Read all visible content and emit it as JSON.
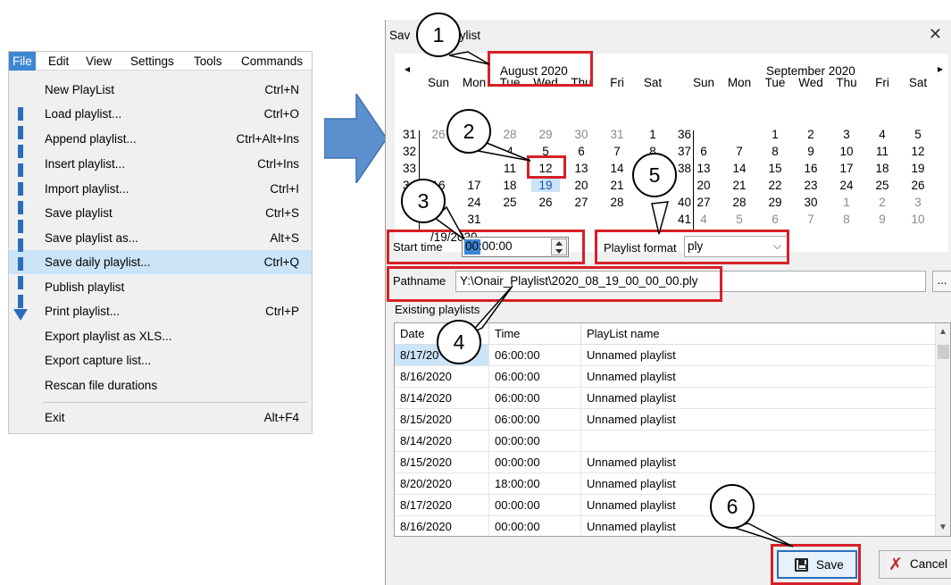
{
  "menubar": [
    {
      "label": "File",
      "active": true
    },
    {
      "label": "Edit"
    },
    {
      "label": "View"
    },
    {
      "label": "Settings"
    },
    {
      "label": "Tools"
    },
    {
      "label": "Commands"
    }
  ],
  "file_menu": [
    {
      "label": "New PlayList",
      "shortcut": "Ctrl+N"
    },
    {
      "label": "Load playlist...",
      "shortcut": "Ctrl+O"
    },
    {
      "label": "Append playlist...",
      "shortcut": "Ctrl+Alt+Ins"
    },
    {
      "label": "Insert playlist...",
      "shortcut": "Ctrl+Ins"
    },
    {
      "label": "Import playlist...",
      "shortcut": "Ctrl+I"
    },
    {
      "label": "Save playlist",
      "shortcut": "Ctrl+S"
    },
    {
      "label": "Save playlist as...",
      "shortcut": "Alt+S"
    },
    {
      "label": "Save daily playlist...",
      "shortcut": "Ctrl+Q",
      "highlighted": true
    },
    {
      "label": "Publish playlist",
      "shortcut": ""
    },
    {
      "label": "Print playlist...",
      "shortcut": "Ctrl+P"
    },
    {
      "label": "Export playlist as XLS...",
      "shortcut": ""
    },
    {
      "label": "Export capture list...",
      "shortcut": ""
    },
    {
      "label": "Rescan file durations",
      "shortcut": ""
    },
    {
      "label": "Exit",
      "shortcut": "Alt+F4"
    }
  ],
  "dialog": {
    "title_left": "Sav",
    "title_right": "aylist",
    "close_glyph": "✕"
  },
  "calendar": {
    "prev_glyph": "◂",
    "next_glyph": "▸",
    "left_month": "August 2020",
    "right_month": "September 2020",
    "weekdays": [
      "Sun",
      "Mon",
      "Tue",
      "Wed",
      "Thu",
      "Fri",
      "Sat"
    ],
    "left_weeks": [
      "31",
      "32",
      "33",
      "34",
      "",
      ""
    ],
    "left_days": [
      [
        "26",
        "",
        "28",
        "29",
        "30",
        "31",
        "1"
      ],
      [
        "",
        "",
        "4",
        "5",
        "6",
        "7",
        "8"
      ],
      [
        "",
        "",
        "11",
        "12",
        "13",
        "14",
        "15"
      ],
      [
        "16",
        "17",
        "18",
        "19",
        "20",
        "21",
        ""
      ],
      [
        "",
        "24",
        "25",
        "26",
        "27",
        "28",
        ""
      ],
      [
        "",
        "31",
        "",
        "",
        "",
        "",
        ""
      ]
    ],
    "right_weeks": [
      "36",
      "37",
      "38",
      "",
      "40",
      "41"
    ],
    "right_days": [
      [
        "",
        "",
        "1",
        "2",
        "3",
        "4",
        "5"
      ],
      [
        "6",
        "7",
        "8",
        "9",
        "10",
        "11",
        "12"
      ],
      [
        "13",
        "14",
        "15",
        "16",
        "17",
        "18",
        "19"
      ],
      [
        "20",
        "21",
        "22",
        "23",
        "24",
        "25",
        "26"
      ],
      [
        "27",
        "28",
        "29",
        "30",
        "1",
        "2",
        "3"
      ],
      [
        "4",
        "5",
        "6",
        "7",
        "8",
        "9",
        "10"
      ]
    ],
    "selected_day": "19",
    "today_partial": "/19/2020",
    "fragment_2": "2",
    "fragment_9": "9",
    "fragment_6": "9"
  },
  "start_time": {
    "label": "Start time",
    "value": "00:00:00"
  },
  "playlist_format": {
    "label": "Playlist format",
    "value": "ply"
  },
  "pathname": {
    "label": "Pathname",
    "value": "Y:\\Onair_Playlist\\2020_08_19_00_00_00.ply",
    "browse": "..."
  },
  "existing": {
    "label": "Existing playlists",
    "columns": [
      "Date",
      "Time",
      "PlayList name"
    ],
    "rows": [
      [
        "8/17/20",
        "06:00:00",
        "Unnamed playlist"
      ],
      [
        "8/16/2020",
        "06:00:00",
        "Unnamed playlist"
      ],
      [
        "8/14/2020",
        "06:00:00",
        "Unnamed playlist"
      ],
      [
        "8/15/2020",
        "06:00:00",
        "Unnamed playlist"
      ],
      [
        "8/14/2020",
        "00:00:00",
        ""
      ],
      [
        "8/15/2020",
        "00:00:00",
        "Unnamed playlist"
      ],
      [
        "8/20/2020",
        "18:00:00",
        "Unnamed playlist"
      ],
      [
        "8/17/2020",
        "00:00:00",
        "Unnamed playlist"
      ],
      [
        "8/16/2020",
        "00:00:00",
        "Unnamed playlist"
      ]
    ]
  },
  "buttons": {
    "save": "Save",
    "cancel": "Cancel",
    "cancel_glyph": "✗"
  },
  "callouts": [
    "1",
    "2",
    "3",
    "4",
    "5",
    "6"
  ],
  "colors": {
    "highlight_box": "#d62027",
    "selection": "#cce4f7",
    "accent": "#3d86d4",
    "arrow": "#5b8fce"
  }
}
